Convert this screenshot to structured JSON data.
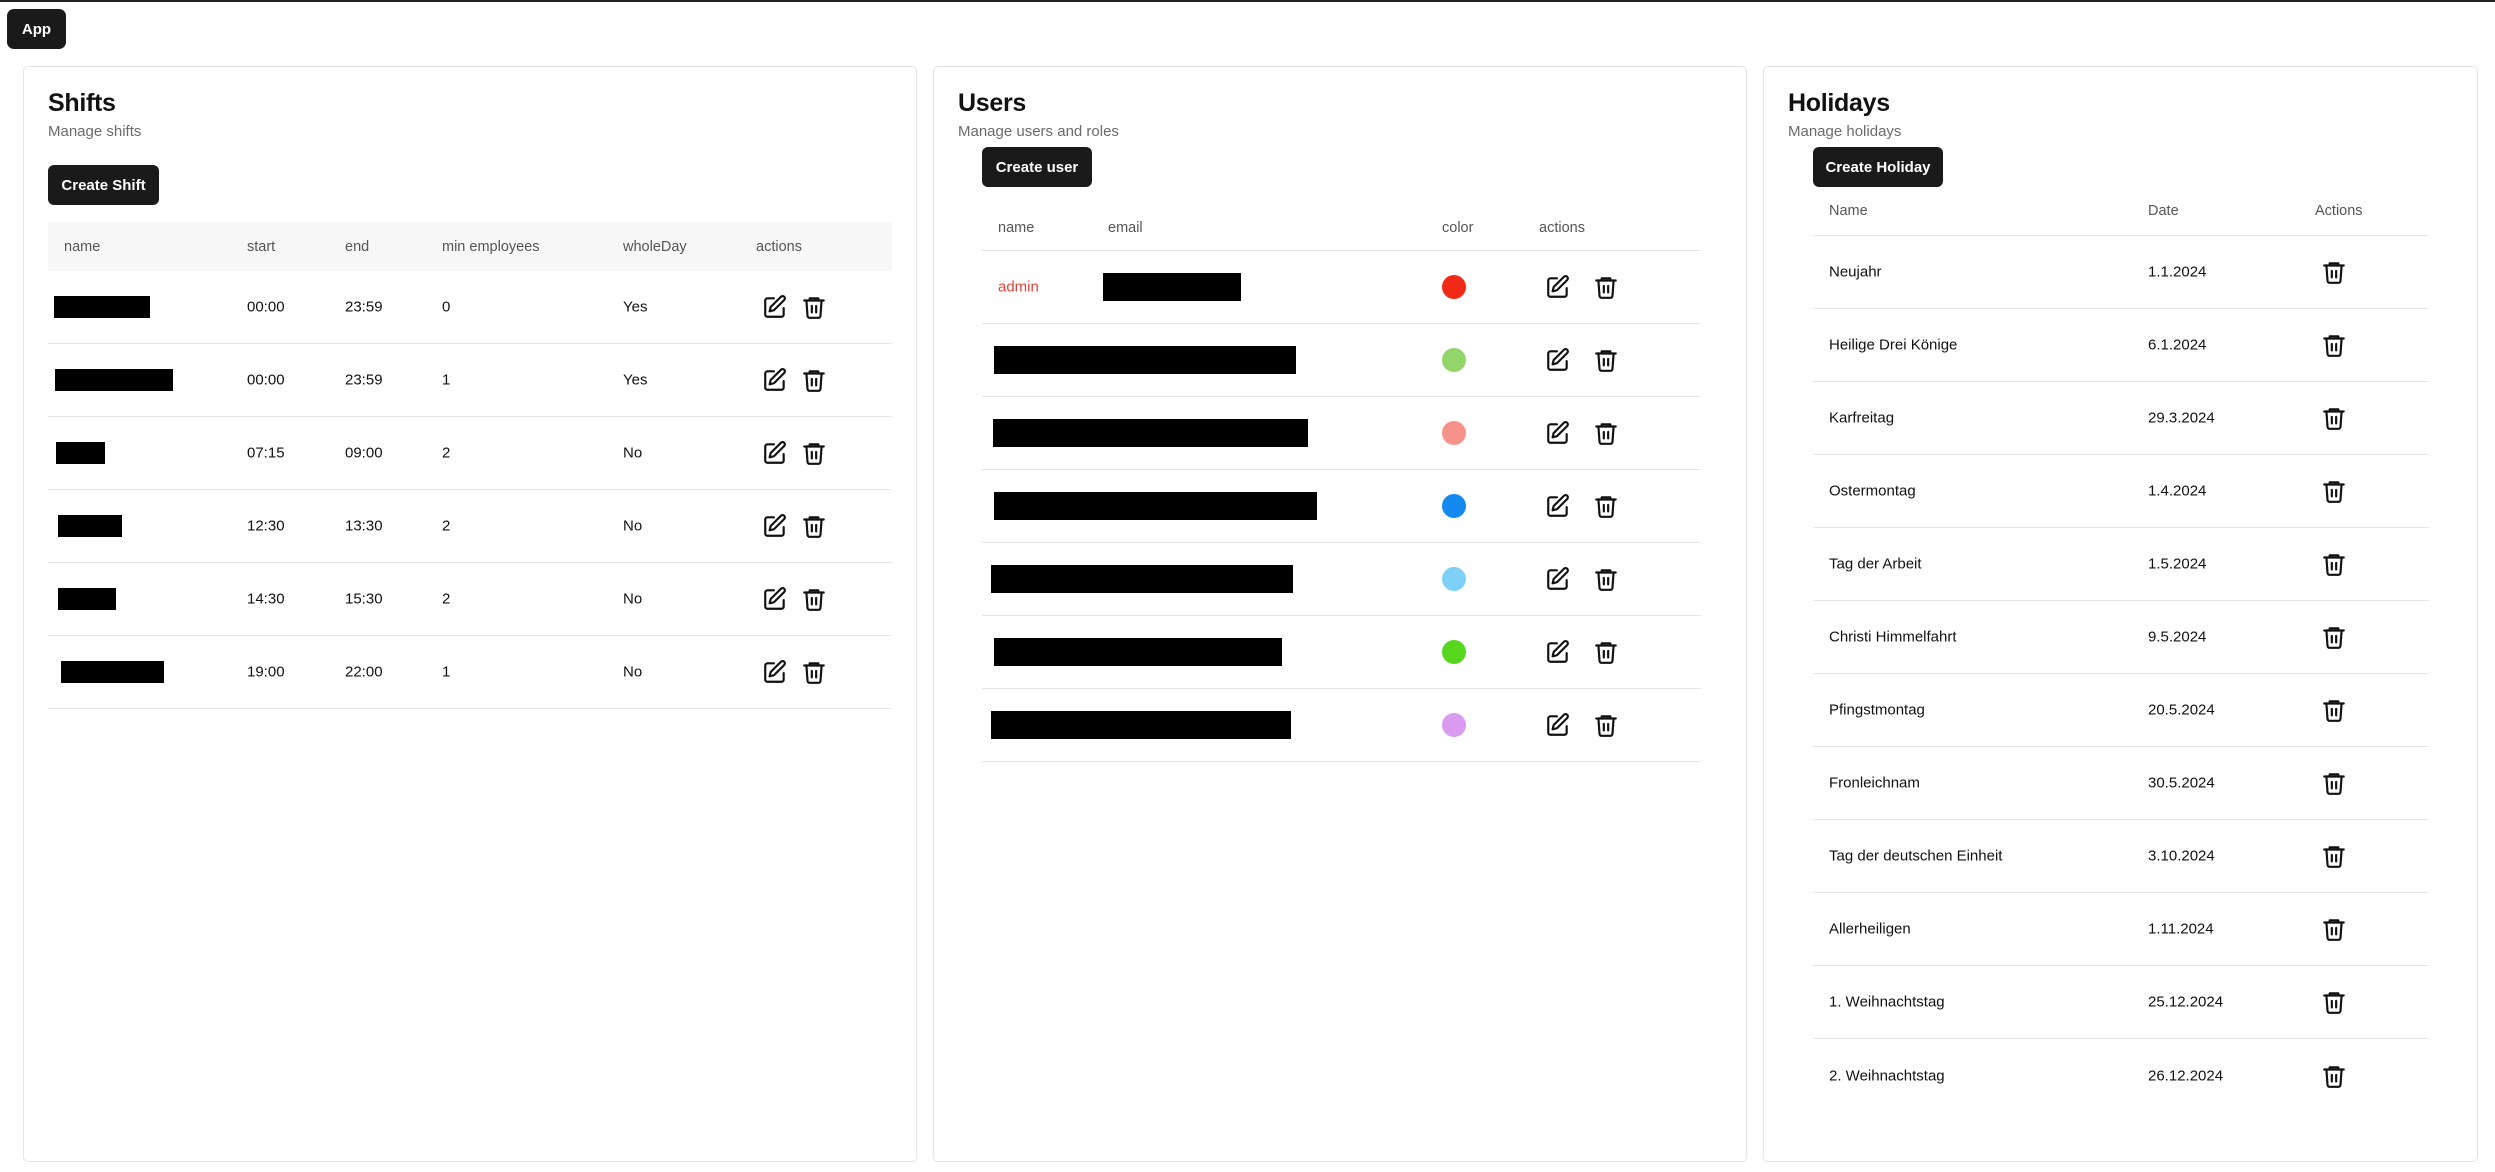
{
  "app_button": "App",
  "shifts": {
    "title": "Shifts",
    "subtitle": "Manage shifts",
    "create_label": "Create Shift",
    "columns": [
      "name",
      "start",
      "end",
      "min employees",
      "wholeDay",
      "actions"
    ],
    "rows": [
      {
        "start": "00:00",
        "end": "23:59",
        "min": "0",
        "whole": "Yes"
      },
      {
        "start": "00:00",
        "end": "23:59",
        "min": "1",
        "whole": "Yes"
      },
      {
        "start": "07:15",
        "end": "09:00",
        "min": "2",
        "whole": "No"
      },
      {
        "start": "12:30",
        "end": "13:30",
        "min": "2",
        "whole": "No"
      },
      {
        "start": "14:30",
        "end": "15:30",
        "min": "2",
        "whole": "No"
      },
      {
        "start": "19:00",
        "end": "22:00",
        "min": "1",
        "whole": "No"
      }
    ]
  },
  "users": {
    "title": "Users",
    "subtitle": "Manage users and roles",
    "create_label": "Create user",
    "columns": [
      "name",
      "email",
      "color",
      "actions"
    ],
    "rows": [
      {
        "name": "admin",
        "color": "#f02a16"
      },
      {
        "name": "",
        "color": "#93d46b"
      },
      {
        "name": "",
        "color": "#f7928a"
      },
      {
        "name": "",
        "color": "#148af0"
      },
      {
        "name": "",
        "color": "#7ed0f7"
      },
      {
        "name": "",
        "color": "#57d61e"
      },
      {
        "name": "",
        "color": "#d99af0"
      }
    ]
  },
  "holidays": {
    "title": "Holidays",
    "subtitle": "Manage holidays",
    "create_label": "Create Holiday",
    "columns": [
      "Name",
      "Date",
      "Actions"
    ],
    "rows": [
      {
        "name": "Neujahr",
        "date": "1.1.2024"
      },
      {
        "name": "Heilige Drei Könige",
        "date": "6.1.2024"
      },
      {
        "name": "Karfreitag",
        "date": "29.3.2024"
      },
      {
        "name": "Ostermontag",
        "date": "1.4.2024"
      },
      {
        "name": "Tag der Arbeit",
        "date": "1.5.2024"
      },
      {
        "name": "Christi Himmelfahrt",
        "date": "9.5.2024"
      },
      {
        "name": "Pfingstmontag",
        "date": "20.5.2024"
      },
      {
        "name": "Fronleichnam",
        "date": "30.5.2024"
      },
      {
        "name": "Tag der deutschen Einheit",
        "date": "3.10.2024"
      },
      {
        "name": "Allerheiligen",
        "date": "1.11.2024"
      },
      {
        "name": "1. Weihnachtstag",
        "date": "25.12.2024"
      },
      {
        "name": "2. Weihnachtstag",
        "date": "26.12.2024"
      }
    ]
  }
}
